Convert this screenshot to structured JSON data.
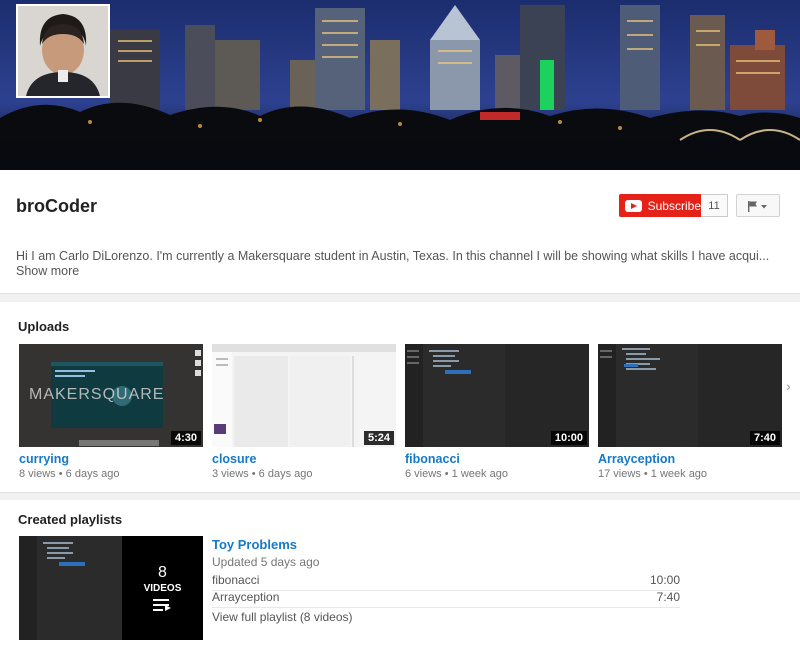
{
  "channel": {
    "name": "broCoder",
    "subscribe_label": "Subscribe",
    "subscriber_count": "11",
    "description": "Hi I am Carlo DiLorenzo. I'm currently a Makersquare student in Austin, Texas. In this channel I will be showing what skills I have acqui...",
    "show_more_label": "Show more",
    "brand_color": "#e62117",
    "link_color": "#167ac6"
  },
  "uploads": {
    "title": "Uploads",
    "videos": [
      {
        "title": "currying",
        "duration": "4:30",
        "views": "8 views",
        "age": "6 days ago",
        "thumb_text": "MAKERSQUARE"
      },
      {
        "title": "closure",
        "duration": "5:24",
        "views": "3 views",
        "age": "6 days ago"
      },
      {
        "title": "fibonacci",
        "duration": "10:00",
        "views": "6 views",
        "age": "1 week ago"
      },
      {
        "title": "Arrayception",
        "duration": "7:40",
        "views": "17 views",
        "age": "1 week ago"
      }
    ]
  },
  "playlists": {
    "title": "Created playlists",
    "playlist": {
      "title": "Toy Problems",
      "updated": "Updated 5 days ago",
      "count": "8",
      "count_label": "VIDEOS",
      "items": [
        {
          "title": "fibonacci",
          "duration": "10:00"
        },
        {
          "title": "Arrayception",
          "duration": "7:40"
        }
      ],
      "view_full_label": "View full playlist (8 videos)"
    }
  }
}
